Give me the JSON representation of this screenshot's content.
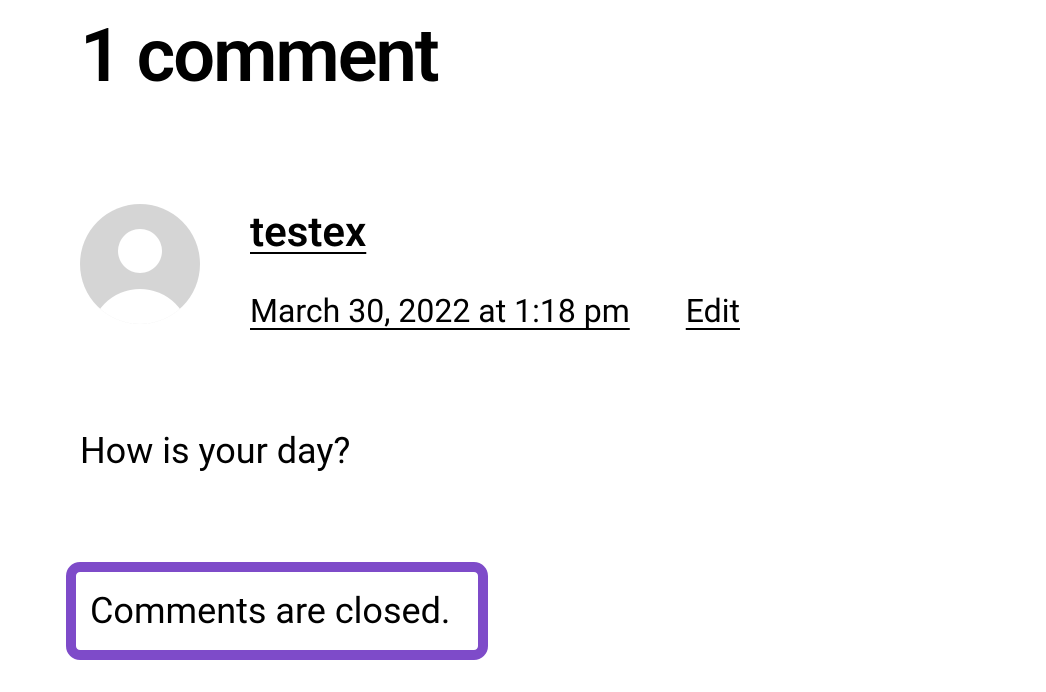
{
  "comments_title": "1 comment",
  "comment": {
    "author": "testex",
    "date": "March 30, 2022 at 1:18 pm",
    "edit_label": "Edit",
    "body": "How is your day?"
  },
  "closed_notice": "Comments are closed.",
  "colors": {
    "highlight_border": "#7e4bc9"
  }
}
